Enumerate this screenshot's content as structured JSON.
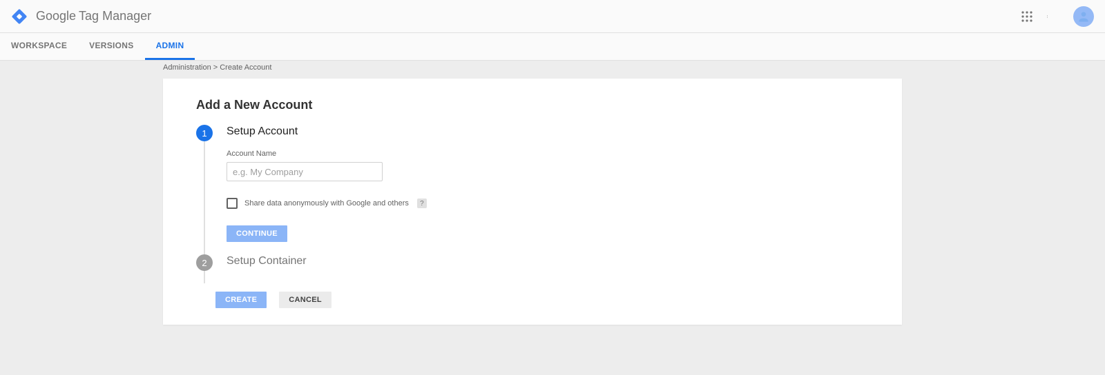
{
  "product": {
    "google": "Google",
    "name": "Tag Manager"
  },
  "nav": {
    "workspace": "WORKSPACE",
    "versions": "VERSIONS",
    "admin": "ADMIN"
  },
  "breadcrumb": "Administration > Create Account",
  "page": {
    "title": "Add a New Account",
    "step1": {
      "num": "1",
      "title": "Setup Account",
      "account_name_label": "Account Name",
      "account_name_placeholder": "e.g. My Company",
      "share_label": "Share data anonymously with Google and others",
      "help": "?",
      "continue": "CONTINUE"
    },
    "step2": {
      "num": "2",
      "title": "Setup Container"
    },
    "create": "CREATE",
    "cancel": "CANCEL"
  }
}
